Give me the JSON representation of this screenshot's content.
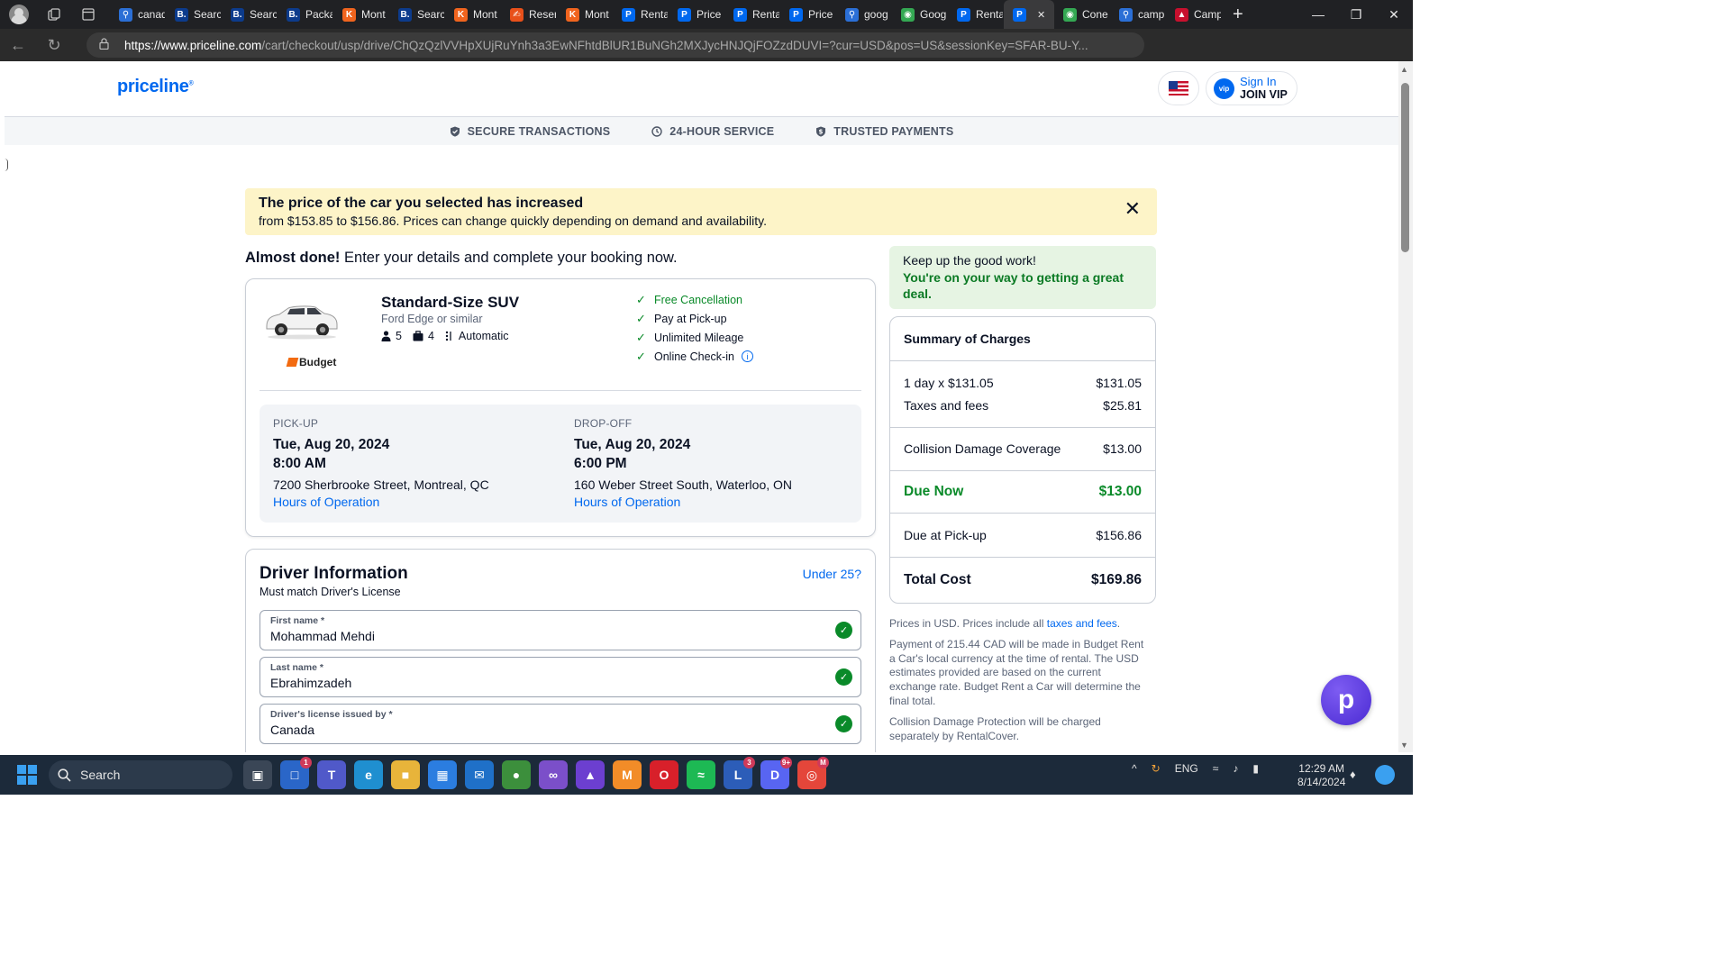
{
  "browser": {
    "tabs": [
      {
        "title": "canad",
        "icon": "search-icon",
        "color": "#2b6fd6"
      },
      {
        "title": "Searc",
        "icon": "booking-icon",
        "color": "#0c3b8c"
      },
      {
        "title": "Searc",
        "icon": "booking-icon",
        "color": "#0c3b8c"
      },
      {
        "title": "Packa",
        "icon": "booking-icon",
        "color": "#0c3b8c"
      },
      {
        "title": "Mont",
        "icon": "kayak-icon",
        "color": "#f0641e"
      },
      {
        "title": "Searc",
        "icon": "booking-icon",
        "color": "#0c3b8c"
      },
      {
        "title": "Mont",
        "icon": "kayak-icon",
        "color": "#f0641e"
      },
      {
        "title": "Reser",
        "icon": "reservation-icon",
        "color": "#e8501a"
      },
      {
        "title": "Mont",
        "icon": "kayak-icon",
        "color": "#f0641e"
      },
      {
        "title": "Renta",
        "icon": "priceline-icon",
        "color": "#0068ef"
      },
      {
        "title": "Price",
        "icon": "priceline-icon",
        "color": "#0068ef"
      },
      {
        "title": "Renta",
        "icon": "priceline-icon",
        "color": "#0068ef"
      },
      {
        "title": "Price",
        "icon": "priceline-icon",
        "color": "#0068ef"
      },
      {
        "title": "goog",
        "icon": "search-icon",
        "color": "#2b6fd6"
      },
      {
        "title": "Goog",
        "icon": "maps-icon",
        "color": "#34a853"
      },
      {
        "title": "Renta",
        "icon": "priceline-icon",
        "color": "#0068ef"
      },
      {
        "title": "",
        "icon": "priceline-icon",
        "color": "#0068ef",
        "active": true
      },
      {
        "title": "Cone",
        "icon": "maps-icon",
        "color": "#34a853"
      },
      {
        "title": "camp",
        "icon": "search-icon",
        "color": "#2b6fd6"
      },
      {
        "title": "Camp",
        "icon": "campsite-icon",
        "color": "#c8102e"
      }
    ],
    "url_host": "https://www.priceline.com",
    "url_path": "/cart/checkout/usp/drive/ChQzQzlVVHpXUjRuYnh3a3EwNFhtdBlUR1BuNGh2MXJycHNJQjFOZzdDUVI=?cur=USD&pos=US&sessionKey=SFAR-BU-Y..."
  },
  "header": {
    "logo": "priceline",
    "sign_in": "Sign In",
    "join_vip": "JOIN VIP",
    "vip_badge": "vip"
  },
  "trust": [
    {
      "label": "SECURE TRANSACTIONS",
      "icon": "shield-check-icon"
    },
    {
      "label": "24-HOUR SERVICE",
      "icon": "clock-icon"
    },
    {
      "label": "TRUSTED PAYMENTS",
      "icon": "shield-dollar-icon"
    }
  ],
  "alert": {
    "title": "The price of the car you selected has increased",
    "body": "from $153.85 to $156.86. Prices can change quickly depending on demand and availability."
  },
  "intro": {
    "bold": "Almost done!",
    "text": " Enter your details and complete your booking now."
  },
  "car": {
    "name": "Standard-Size SUV",
    "model": "Ford Edge or similar",
    "passengers": "5",
    "bags": "4",
    "transmission": "Automatic",
    "brand": "Budget",
    "perks": [
      "Free Cancellation",
      "Pay at Pick-up",
      "Unlimited Mileage",
      "Online Check-in"
    ]
  },
  "trip": {
    "pickup": {
      "label": "PICK-UP",
      "date": "Tue, Aug 20, 2024",
      "time": "8:00 AM",
      "address": "7200 Sherbrooke Street, Montreal, QC",
      "link": "Hours of Operation"
    },
    "dropoff": {
      "label": "DROP-OFF",
      "date": "Tue, Aug 20, 2024",
      "time": "6:00 PM",
      "address": "160 Weber Street South, Waterloo, ON",
      "link": "Hours of Operation"
    }
  },
  "driver": {
    "title": "Driver Information",
    "subtitle": "Must match Driver's License",
    "under25": "Under 25?",
    "fields": [
      {
        "label": "First name *",
        "value": "Mohammad Mehdi"
      },
      {
        "label": "Last name *",
        "value": "Ebrahimzadeh"
      },
      {
        "label": "Driver's license issued by *",
        "value": "Canada"
      }
    ]
  },
  "promo": {
    "line1": "Keep up the good work!",
    "line2": "You're on your way to getting a great deal."
  },
  "summary": {
    "title": "Summary of Charges",
    "rate_label": "1 day x $131.05",
    "rate_value": "$131.05",
    "taxes_label": "Taxes and fees",
    "taxes_value": "$25.81",
    "cdc_label": "Collision Damage Coverage",
    "cdc_value": "$13.00",
    "due_now_label": "Due Now",
    "due_now_value": "$13.00",
    "pickup_label": "Due at Pick-up",
    "pickup_value": "$156.86",
    "total_label": "Total Cost",
    "total_value": "$169.86"
  },
  "notes": {
    "n1_text": "Prices in USD. Prices include all ",
    "n1_link": "taxes and fees",
    "n1_end": ".",
    "n2": "Payment of 215.44 CAD will be made in Budget Rent a Car's local currency at the time of rental. The USD estimates provided are based on the current exchange rate. Budget Rent a Car will determine the final total.",
    "n3": "Collision Damage Protection will be charged separately by RentalCover."
  },
  "taskbar": {
    "search": "Search",
    "lang": "ENG",
    "time": "12:29 AM",
    "date": "8/14/2024",
    "badges": {
      "teams_store": "1",
      "l_app": "3",
      "discord": "9+",
      "chrome": "M"
    }
  },
  "colors": {
    "brand": "#0068ef",
    "success": "#0a8a29",
    "alert_bg": "#fdf4c8",
    "promo_bg": "#e6f4e3"
  }
}
